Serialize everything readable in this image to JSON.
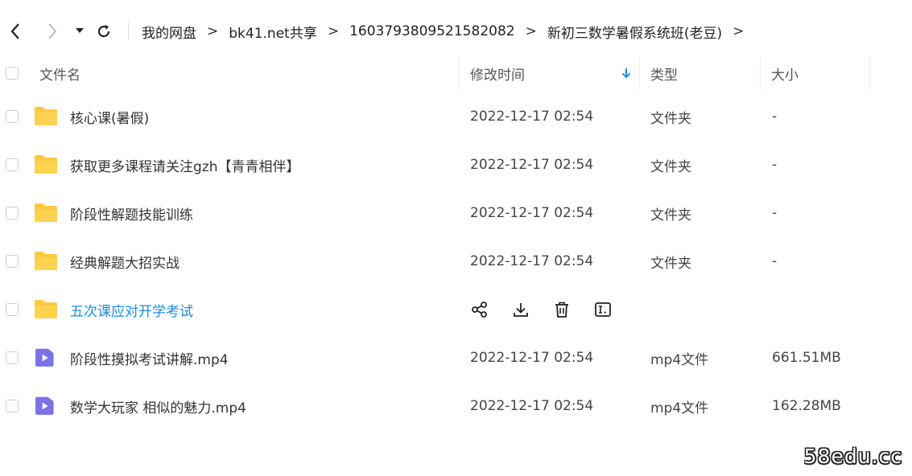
{
  "breadcrumb": {
    "items": [
      "我的网盘",
      "bk41.net共享",
      "1603793809521582082",
      "新初三数学暑假系统班(老豆)"
    ],
    "separator": ">"
  },
  "table": {
    "headers": {
      "name": "文件名",
      "modified": "修改时间",
      "type": "类型",
      "size": "大小"
    },
    "sort_icon": "arrow-down-icon",
    "rows": [
      {
        "name": "核心课(暑假)",
        "modified": "2022-12-17 02:54",
        "type": "文件夹",
        "size": "-",
        "icon": "folder-icon"
      },
      {
        "name": "获取更多课程请关注gzh【青青相伴】",
        "modified": "2022-12-17 02:54",
        "type": "文件夹",
        "size": "-",
        "icon": "folder-icon"
      },
      {
        "name": "阶段性解题技能训练",
        "modified": "2022-12-17 02:54",
        "type": "文件夹",
        "size": "-",
        "icon": "folder-icon"
      },
      {
        "name": "经典解题大招实战",
        "modified": "2022-12-17 02:54",
        "type": "文件夹",
        "size": "-",
        "icon": "folder-icon"
      },
      {
        "name": "五次课应对开学考试",
        "icon": "folder-icon",
        "hovered": true,
        "actions": [
          "share-icon",
          "download-icon",
          "delete-icon",
          "rename-icon"
        ]
      },
      {
        "name": "阶段性摸拟考试讲解.mp4",
        "modified": "2022-12-17 02:54",
        "type": "mp4文件",
        "size": "661.51MB",
        "icon": "video-file-icon"
      },
      {
        "name": "数学大玩家 相似的魅力.mp4",
        "modified": "2022-12-17 02:54",
        "type": "mp4文件",
        "size": "162.28MB",
        "icon": "video-file-icon"
      }
    ]
  },
  "watermark": "58edu.cc",
  "colors": {
    "folder": "#FFC93C",
    "video": "#7B72E8",
    "link": "#1B8ED9",
    "sort_arrow": "#1E8FE1"
  }
}
